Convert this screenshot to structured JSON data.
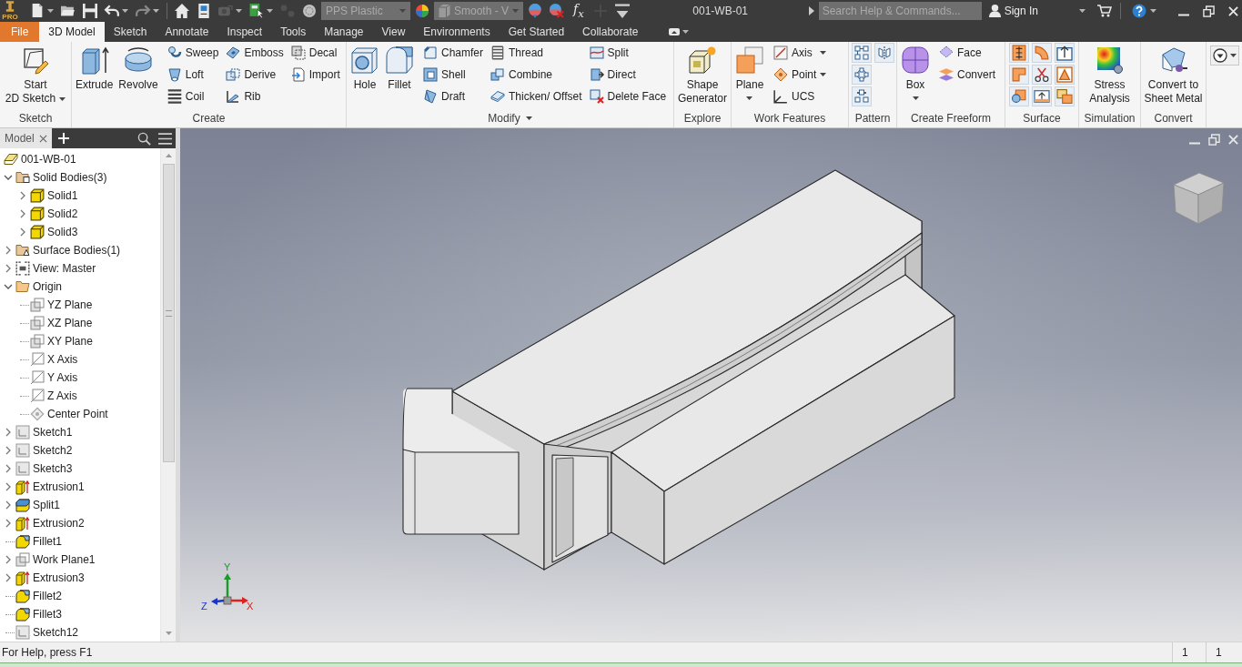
{
  "app": {
    "edition": "PRO",
    "title": "001-WB-01"
  },
  "quick_access": [
    {
      "kind": "new",
      "menu": true,
      "disabled": false
    },
    {
      "kind": "open",
      "menu": false,
      "disabled": false
    },
    {
      "kind": "save",
      "menu": false,
      "disabled": false
    },
    {
      "kind": "undo",
      "menu": true,
      "disabled": false
    },
    {
      "kind": "redo",
      "menu": true,
      "disabled": true
    },
    {
      "kind": "separator"
    },
    {
      "kind": "home",
      "menu": false,
      "disabled": false
    },
    {
      "kind": "properties",
      "menu": false,
      "disabled": false
    },
    {
      "kind": "update",
      "menu": true,
      "disabled": true
    },
    {
      "kind": "select",
      "menu": true,
      "disabled": false
    },
    {
      "kind": "dots",
      "menu": false,
      "disabled": true
    },
    {
      "kind": "appearance",
      "menu": false,
      "disabled": false
    },
    {
      "kind": "material",
      "value": "PPS Plastic",
      "menu": true,
      "disabled": false
    },
    {
      "kind": "color",
      "menu": false,
      "disabled": false
    },
    {
      "kind": "visual-style",
      "value": "Smooth - V",
      "menu": true,
      "disabled": false
    },
    {
      "kind": "adjust",
      "menu": false,
      "disabled": false
    },
    {
      "kind": "clear",
      "menu": false,
      "disabled": false
    },
    {
      "kind": "formula",
      "label": "f$_{x}$",
      "menu": false,
      "disabled": false
    },
    {
      "kind": "plus",
      "menu": false,
      "disabled": true
    },
    {
      "kind": "customize",
      "menu": false,
      "disabled": false
    }
  ],
  "search": {
    "placeholder": "Search Help & Commands..."
  },
  "account": {
    "label": "Sign In"
  },
  "ribbon": {
    "tabs": [
      {
        "label": "File",
        "kind": "application",
        "selected": false
      },
      {
        "label": "3D Model",
        "kind": "tab",
        "selected": true
      },
      {
        "label": "Sketch",
        "kind": "tab",
        "selected": false
      },
      {
        "label": "Annotate",
        "kind": "tab",
        "selected": false
      },
      {
        "label": "Inspect",
        "kind": "tab",
        "selected": false
      },
      {
        "label": "Tools",
        "kind": "tab",
        "selected": false
      },
      {
        "label": "Manage",
        "kind": "tab",
        "selected": false
      },
      {
        "label": "View",
        "kind": "tab",
        "selected": false
      },
      {
        "label": "Environments",
        "kind": "tab",
        "selected": false
      },
      {
        "label": "Get Started",
        "kind": "tab",
        "selected": false
      },
      {
        "label": "Collaborate",
        "kind": "tab",
        "selected": false
      }
    ],
    "panels": [
      {
        "title": "Sketch",
        "menu": false,
        "tools": [
          {
            "kind": "large",
            "lines": [
              "Start",
              "2D Sketch"
            ],
            "menu": true
          }
        ]
      },
      {
        "title": "Create",
        "menu": false,
        "tools": [
          {
            "kind": "large",
            "lines": [
              "Extrude"
            ],
            "menu": false
          },
          {
            "kind": "large",
            "lines": [
              "Revolve"
            ],
            "menu": false
          },
          {
            "kind": "small",
            "label": "Sweep",
            "menu": false
          },
          {
            "kind": "small",
            "label": "Loft",
            "menu": false
          },
          {
            "kind": "small",
            "label": "Coil",
            "menu": false
          },
          {
            "kind": "small",
            "label": "Emboss",
            "menu": false
          },
          {
            "kind": "small",
            "label": "Derive",
            "menu": false
          },
          {
            "kind": "small",
            "label": "Rib",
            "menu": false
          },
          {
            "kind": "small",
            "label": "Decal",
            "menu": false
          },
          {
            "kind": "small",
            "label": "Import",
            "menu": false
          }
        ]
      },
      {
        "title": "Modify",
        "menu": true,
        "tools": [
          {
            "kind": "large",
            "lines": [
              "Hole"
            ],
            "menu": false
          },
          {
            "kind": "large",
            "lines": [
              "Fillet"
            ],
            "menu": false
          },
          {
            "kind": "small",
            "label": "Chamfer",
            "menu": false
          },
          {
            "kind": "small",
            "label": "Shell",
            "menu": false
          },
          {
            "kind": "small",
            "label": "Draft",
            "menu": false
          },
          {
            "kind": "small",
            "label": "Thread",
            "menu": false
          },
          {
            "kind": "small",
            "label": "Combine",
            "menu": false
          },
          {
            "kind": "small",
            "label": "Thicken/ Offset",
            "menu": false
          },
          {
            "kind": "small",
            "label": "Split",
            "menu": false
          },
          {
            "kind": "small",
            "label": "Direct",
            "menu": false
          },
          {
            "kind": "small",
            "label": "Delete Face",
            "menu": false
          }
        ]
      },
      {
        "title": "Explore",
        "menu": false,
        "tools": [
          {
            "kind": "large",
            "lines": [
              "Shape",
              "Generator"
            ],
            "menu": false
          }
        ]
      },
      {
        "title": "Work Features",
        "menu": false,
        "tools": [
          {
            "kind": "large",
            "lines": [
              "Plane"
            ],
            "menu": true
          },
          {
            "kind": "small",
            "label": "Axis",
            "menu": true
          },
          {
            "kind": "small",
            "label": "Point",
            "menu": true
          },
          {
            "kind": "small",
            "label": "UCS",
            "menu": false
          }
        ]
      },
      {
        "title": "Pattern",
        "menu": false,
        "tools": [
          {
            "kind": "icon",
            "menu": false
          },
          {
            "kind": "icon",
            "menu": false
          },
          {
            "kind": "icon",
            "menu": false
          },
          {
            "kind": "icon",
            "menu": false
          }
        ]
      },
      {
        "title": "Create Freeform",
        "menu": false,
        "tools": [
          {
            "kind": "large",
            "lines": [
              "Box"
            ],
            "menu": true
          },
          {
            "kind": "small",
            "label": "Face",
            "menu": false
          },
          {
            "kind": "small",
            "label": "Convert",
            "menu": false
          }
        ]
      },
      {
        "title": "Surface",
        "menu": false,
        "tools": [
          {
            "kind": "icon",
            "menu": false
          },
          {
            "kind": "icon",
            "menu": false
          },
          {
            "kind": "icon",
            "menu": false
          },
          {
            "kind": "icon",
            "menu": false
          },
          {
            "kind": "icon",
            "menu": false
          },
          {
            "kind": "icon",
            "menu": false
          },
          {
            "kind": "icon",
            "menu": false
          },
          {
            "kind": "icon",
            "menu": false
          },
          {
            "kind": "icon",
            "menu": false
          }
        ]
      },
      {
        "title": "Simulation",
        "menu": false,
        "tools": [
          {
            "kind": "large",
            "lines": [
              "Stress",
              "Analysis"
            ],
            "menu": false
          }
        ]
      },
      {
        "title": "Convert",
        "menu": false,
        "tools": [
          {
            "kind": "large",
            "lines": [
              "Convert to",
              "Sheet Metal"
            ],
            "menu": false
          }
        ]
      }
    ]
  },
  "browser": {
    "tabs": [
      {
        "label": "Model",
        "selected": true
      }
    ],
    "tree": {
      "label": "001-WB-01",
      "kind": "part",
      "children": [
        {
          "label": "Solid Bodies(3)",
          "kind": "bodies",
          "expanded": true,
          "children": [
            {
              "label": "Solid1",
              "kind": "solid",
              "expanded": false
            },
            {
              "label": "Solid2",
              "kind": "solid",
              "expanded": false
            },
            {
              "label": "Solid3",
              "kind": "solid",
              "expanded": false
            }
          ]
        },
        {
          "label": "Surface Bodies(1)",
          "kind": "surfaces",
          "expanded": false
        },
        {
          "label": "View: Master",
          "kind": "view",
          "expanded": false
        },
        {
          "label": "Origin",
          "kind": "folder",
          "expanded": true,
          "children": [
            {
              "label": "YZ Plane",
              "kind": "plane"
            },
            {
              "label": "XZ Plane",
              "kind": "plane"
            },
            {
              "label": "XY Plane",
              "kind": "plane"
            },
            {
              "label": "X Axis",
              "kind": "axis"
            },
            {
              "label": "Y Axis",
              "kind": "axis"
            },
            {
              "label": "Z Axis",
              "kind": "axis"
            },
            {
              "label": "Center Point",
              "kind": "point"
            }
          ]
        },
        {
          "label": "Sketch1",
          "kind": "sketch",
          "expanded": false
        },
        {
          "label": "Sketch2",
          "kind": "sketch",
          "expanded": false
        },
        {
          "label": "Sketch3",
          "kind": "sketch",
          "expanded": false
        },
        {
          "label": "Extrusion1",
          "kind": "extrusion",
          "expanded": false
        },
        {
          "label": "Split1",
          "kind": "split",
          "expanded": false
        },
        {
          "label": "Extrusion2",
          "kind": "extrusion",
          "expanded": false
        },
        {
          "label": "Fillet1",
          "kind": "fillet"
        },
        {
          "label": "Work Plane1",
          "kind": "work-plane",
          "expanded": false
        },
        {
          "label": "Extrusion3",
          "kind": "extrusion",
          "expanded": false
        },
        {
          "label": "Fillet2",
          "kind": "fillet"
        },
        {
          "label": "Fillet3",
          "kind": "fillet"
        },
        {
          "label": "Sketch12",
          "kind": "sketch"
        }
      ]
    }
  },
  "viewport": {
    "triad": [
      {
        "label": "X",
        "color": "#e0201c"
      },
      {
        "label": "Y",
        "color": "#1c9a2a"
      },
      {
        "label": "Z",
        "color": "#1c34c8"
      }
    ]
  },
  "status_bar": {
    "message": "For Help, press F1",
    "cells": [
      "1",
      "1"
    ]
  }
}
